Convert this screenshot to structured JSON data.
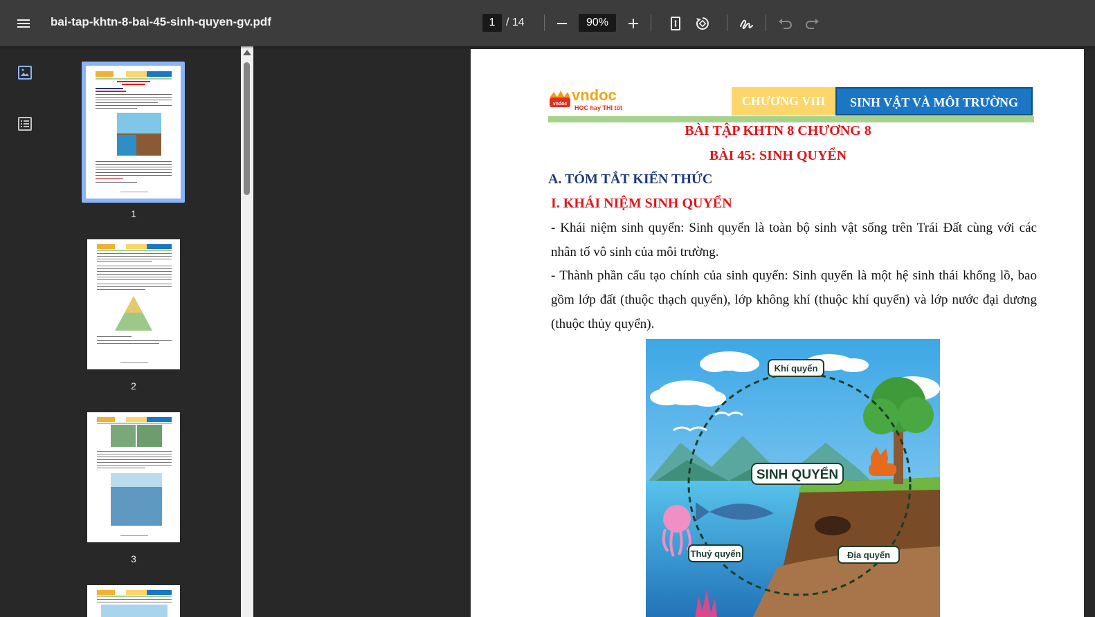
{
  "toolbar": {
    "filename": "bai-tap-khtn-8-bai-45-sinh-quyen-gv.pdf",
    "current_page": "1",
    "total_pages": "/ 14",
    "zoom": "90%"
  },
  "thumbnails": [
    {
      "number": "1",
      "selected": true
    },
    {
      "number": "2",
      "selected": false
    },
    {
      "number": "3",
      "selected": false
    }
  ],
  "page": {
    "logo_text": "vndoc",
    "logo_tagline": "HỌC hay THI tốt",
    "chapter_label": "CHƯƠNG VIII",
    "chapter_title": "SINH VẬT VÀ MÔI TRƯỜNG",
    "title_line1": "BÀI TẬP KHTN 8 CHƯƠNG 8",
    "title_line2": "BÀI 45: SINH QUYỂN",
    "section_a": "A. TÓM TẮT KIẾN THỨC",
    "section_i": "I. KHÁI NIỆM SINH QUYỂN",
    "para1": "- Khái niệm sinh quyển: Sinh quyển là toàn bộ sinh vật sống trên Trái Đất cùng với các nhân tố vô sinh của môi trường.",
    "para2": "- Thành phần cấu tạo chính của sinh quyển: Sinh quyển là một hệ sinh thái khổng lồ, bao gồm lớp đất (thuộc thạch quyển), lớp không khí (thuộc khí quyển) và lớp nước đại dương (thuộc thủy quyển).",
    "figure": {
      "center_label": "SINH QUYỂN",
      "atmosphere_label": "Khí quyển",
      "hydrosphere_label": "Thuỷ quyển",
      "lithosphere_label": "Địa quyển"
    }
  },
  "colors": {
    "toolbar_bg": "#3c3c3c",
    "viewer_bg": "#282828",
    "title_red": "#e3141b",
    "heading_blue": "#1f3a7a",
    "chapter_yellow": "#fcd66b",
    "chapter_blue": "#1b76c4",
    "selection_blue": "#8ab4f8"
  }
}
